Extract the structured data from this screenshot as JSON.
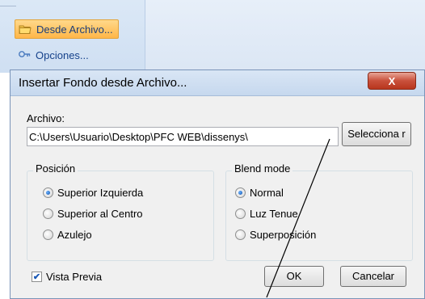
{
  "menu": {
    "items": [
      {
        "label": "Desde Archivo...",
        "icon": "folder-icon",
        "active": true
      },
      {
        "label": "Opciones...",
        "icon": "options-icon",
        "active": false
      }
    ]
  },
  "dialog": {
    "title": "Insertar Fondo desde Archivo...",
    "close_label": "X",
    "file_label": "Archivo:",
    "file_path": "C:\\Users\\Usuario\\Desktop\\PFC WEB\\dissenys\\",
    "browse_label": "Selecciona r",
    "position_group": {
      "title": "Posición",
      "options": [
        {
          "label": "Superior Izquierda",
          "checked": true
        },
        {
          "label": "Superior al Centro",
          "checked": false
        },
        {
          "label": "Azulejo",
          "checked": false
        }
      ]
    },
    "blend_group": {
      "title": "Blend mode",
      "options": [
        {
          "label": "Normal",
          "checked": true
        },
        {
          "label": "Luz Tenue",
          "checked": false
        },
        {
          "label": "Superposición",
          "checked": false
        }
      ]
    },
    "preview_label": "Vista Previa",
    "preview_checked": true,
    "ok_label": "OK",
    "cancel_label": "Cancelar"
  },
  "colors": {
    "accent": "#ffb648",
    "ribbon_text": "#15428b",
    "close_button": "#c9503b"
  }
}
